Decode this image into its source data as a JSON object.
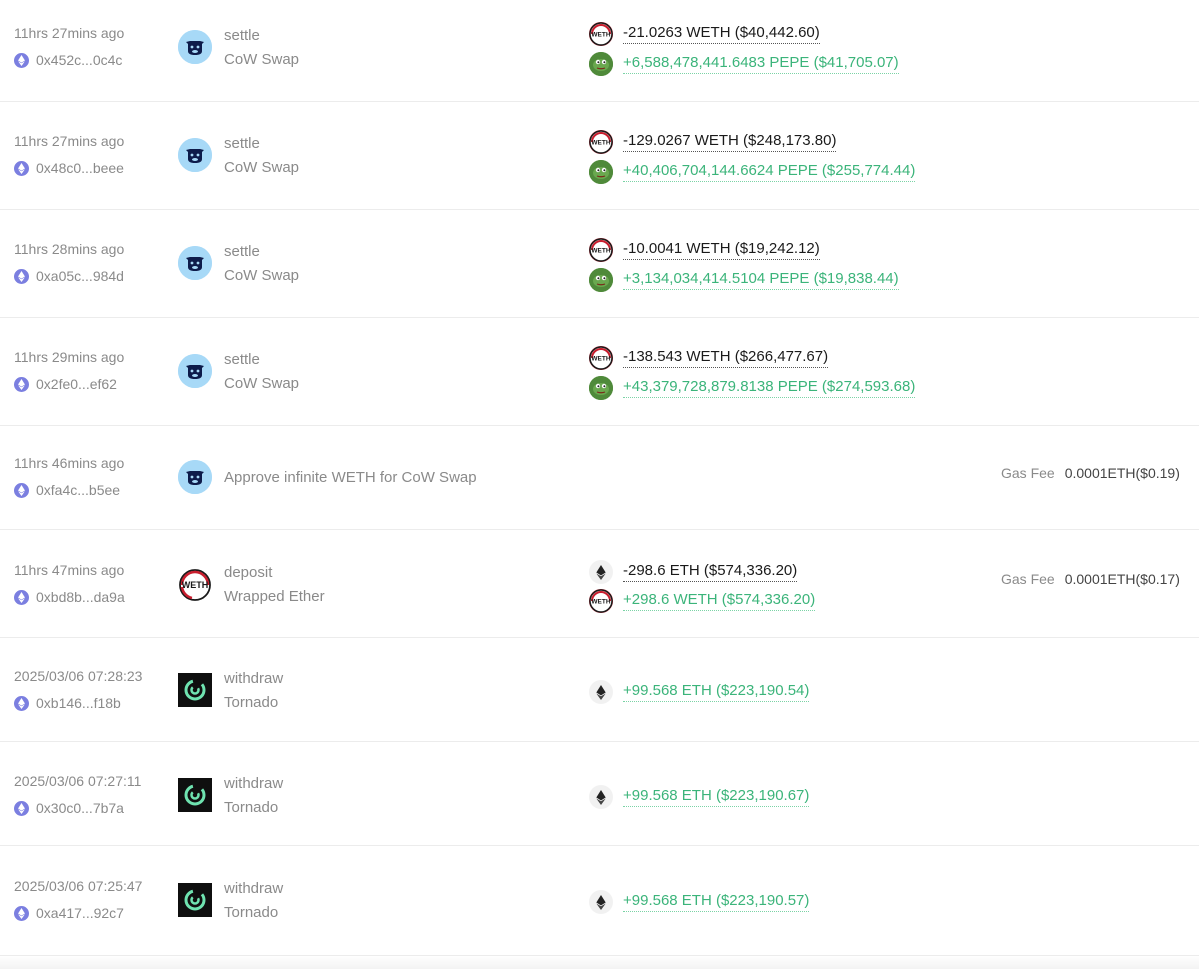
{
  "transactions": [
    {
      "time": "11hrs 27mins ago",
      "hash": "0x452c...0c4c",
      "method": "settle",
      "protocol": "CoW Swap",
      "logo": "cow-icon",
      "changes": [
        {
          "token_icon": "weth-icon",
          "amount": "-21.0263 WETH ($40,442.60)",
          "sign": "neg"
        },
        {
          "token_icon": "pepe-icon",
          "amount": "+6,588,478,441.6483 PEPE ($41,705.07)",
          "sign": "pos"
        }
      ],
      "gas_label": "",
      "gas_value": ""
    },
    {
      "time": "11hrs 27mins ago",
      "hash": "0x48c0...beee",
      "method": "settle",
      "protocol": "CoW Swap",
      "logo": "cow-icon",
      "changes": [
        {
          "token_icon": "weth-icon",
          "amount": "-129.0267 WETH ($248,173.80)",
          "sign": "neg"
        },
        {
          "token_icon": "pepe-icon",
          "amount": "+40,406,704,144.6624 PEPE ($255,774.44)",
          "sign": "pos"
        }
      ],
      "gas_label": "",
      "gas_value": ""
    },
    {
      "time": "11hrs 28mins ago",
      "hash": "0xa05c...984d",
      "method": "settle",
      "protocol": "CoW Swap",
      "logo": "cow-icon",
      "changes": [
        {
          "token_icon": "weth-icon",
          "amount": "-10.0041 WETH ($19,242.12)",
          "sign": "neg"
        },
        {
          "token_icon": "pepe-icon",
          "amount": "+3,134,034,414.5104 PEPE ($19,838.44)",
          "sign": "pos"
        }
      ],
      "gas_label": "",
      "gas_value": ""
    },
    {
      "time": "11hrs 29mins ago",
      "hash": "0x2fe0...ef62",
      "method": "settle",
      "protocol": "CoW Swap",
      "logo": "cow-icon",
      "changes": [
        {
          "token_icon": "weth-icon",
          "amount": "-138.543 WETH ($266,477.67)",
          "sign": "neg"
        },
        {
          "token_icon": "pepe-icon",
          "amount": "+43,379,728,879.8138 PEPE ($274,593.68)",
          "sign": "pos"
        }
      ],
      "gas_label": "",
      "gas_value": ""
    },
    {
      "time": "11hrs 46mins ago",
      "hash": "0xfa4c...b5ee",
      "method": "Approve infinite WETH for CoW Swap",
      "protocol": "",
      "logo": "cow-icon",
      "changes": [],
      "gas_label": "Gas Fee",
      "gas_value": "0.0001ETH($0.19)"
    },
    {
      "time": "11hrs 47mins ago",
      "hash": "0xbd8b...da9a",
      "method": "deposit",
      "protocol": "Wrapped Ether",
      "logo": "weth-icon",
      "changes": [
        {
          "token_icon": "eth-icon",
          "amount": "-298.6 ETH ($574,336.20)",
          "sign": "neg"
        },
        {
          "token_icon": "weth-icon",
          "amount": "+298.6 WETH ($574,336.20)",
          "sign": "pos"
        }
      ],
      "gas_label": "Gas Fee",
      "gas_value": "0.0001ETH($0.17)"
    },
    {
      "time": "2025/03/06 07:28:23",
      "hash": "0xb146...f18b",
      "method": "withdraw",
      "protocol": "Tornado",
      "logo": "tornado-icon",
      "changes": [
        {
          "token_icon": "eth-icon",
          "amount": "+99.568 ETH ($223,190.54)",
          "sign": "pos"
        }
      ],
      "gas_label": "",
      "gas_value": ""
    },
    {
      "time": "2025/03/06 07:27:11",
      "hash": "0x30c0...7b7a",
      "method": "withdraw",
      "protocol": "Tornado",
      "logo": "tornado-icon",
      "changes": [
        {
          "token_icon": "eth-icon",
          "amount": "+99.568 ETH ($223,190.67)",
          "sign": "pos"
        }
      ],
      "gas_label": "",
      "gas_value": ""
    },
    {
      "time": "2025/03/06 07:25:47",
      "hash": "0xa417...92c7",
      "method": "withdraw",
      "protocol": "Tornado",
      "logo": "tornado-icon",
      "changes": [
        {
          "token_icon": "eth-icon",
          "amount": "+99.568 ETH ($223,190.57)",
          "sign": "pos"
        }
      ],
      "gas_label": "",
      "gas_value": ""
    }
  ],
  "colors": {
    "positive": "#3bb47a",
    "negative": "#1a1a1a",
    "muted": "#8a8a8a",
    "eth_badge": "#7b7fe0",
    "cow_bg": "#a7d9f7",
    "pepe": "#4f8a3a",
    "tornado_bg": "#0f0f0f",
    "tornado_swirl": "#6fe3b0"
  }
}
